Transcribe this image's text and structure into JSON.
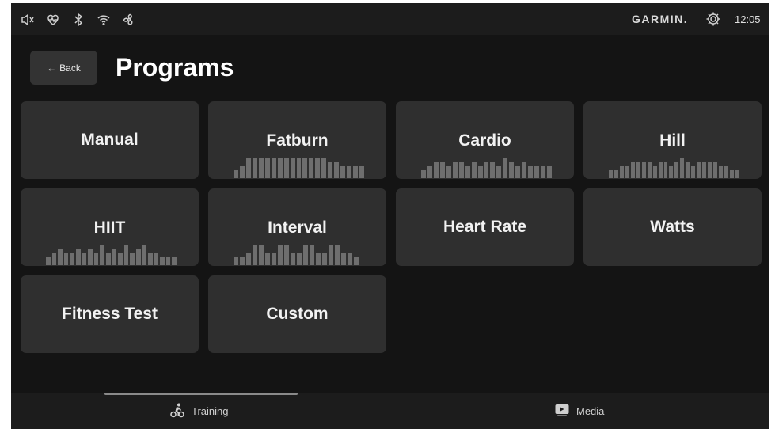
{
  "status_bar": {
    "icons": [
      "volume-icon",
      "heart-rate-icon",
      "bluetooth-icon",
      "wifi-icon",
      "fan-icon"
    ],
    "brand": "GARMIN.",
    "settings_icon": "gear-icon",
    "time": "12:05"
  },
  "header": {
    "back_arrow": "←",
    "back_label": "Back",
    "title": "Programs"
  },
  "programs": [
    {
      "label": "Manual",
      "profile": []
    },
    {
      "label": "Fatburn",
      "profile": [
        2,
        3,
        5,
        5,
        5,
        5,
        5,
        5,
        5,
        5,
        5,
        5,
        5,
        5,
        5,
        4,
        4,
        3,
        3,
        3,
        3
      ]
    },
    {
      "label": "Cardio",
      "profile": [
        2,
        3,
        4,
        4,
        3,
        4,
        4,
        3,
        4,
        3,
        4,
        4,
        3,
        5,
        4,
        3,
        4,
        3,
        3,
        3,
        3
      ]
    },
    {
      "label": "Hill",
      "profile": [
        2,
        2,
        3,
        3,
        4,
        4,
        4,
        4,
        3,
        4,
        4,
        3,
        4,
        5,
        4,
        3,
        4,
        4,
        4,
        4,
        3,
        3,
        2,
        2
      ]
    },
    {
      "label": "HIIT",
      "profile": [
        2,
        3,
        4,
        3,
        3,
        4,
        3,
        4,
        3,
        5,
        3,
        4,
        3,
        5,
        3,
        4,
        5,
        3,
        3,
        2,
        2,
        2
      ]
    },
    {
      "label": "Interval",
      "profile": [
        2,
        2,
        3,
        5,
        5,
        3,
        3,
        5,
        5,
        3,
        3,
        5,
        5,
        3,
        3,
        5,
        5,
        3,
        3,
        2
      ]
    },
    {
      "label": "Heart Rate",
      "profile": []
    },
    {
      "label": "Watts",
      "profile": []
    },
    {
      "label": "Fitness Test",
      "profile": []
    },
    {
      "label": "Custom",
      "profile": []
    }
  ],
  "bottom_nav": {
    "items": [
      {
        "label": "Training",
        "icon": "cyclist-icon",
        "active": true
      },
      {
        "label": "Media",
        "icon": "play-icon",
        "active": false
      }
    ]
  },
  "colors": {
    "background": "#141414",
    "bar": "#1c1c1c",
    "tile": "#2f2f2f",
    "profile_bar": "#6e6e6e"
  }
}
